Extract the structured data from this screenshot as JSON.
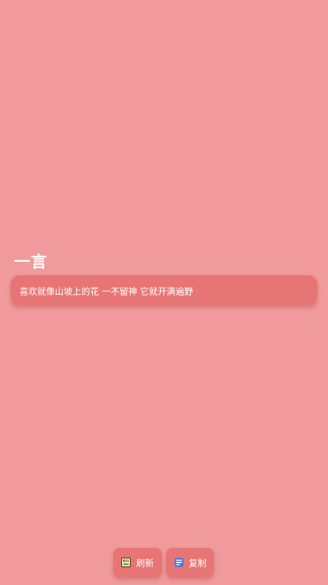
{
  "page": {
    "title": "一言",
    "quote": "喜欢就像山坡上的花 一不留神 它就开满遍野"
  },
  "actions": {
    "refresh_label": "刷新",
    "refresh_icon": "refresh-icon",
    "copy_label": "复制",
    "copy_icon": "copy-icon"
  },
  "colors": {
    "background": "#F09A9B",
    "card": "#E77575",
    "text": "#FFFFFF"
  }
}
